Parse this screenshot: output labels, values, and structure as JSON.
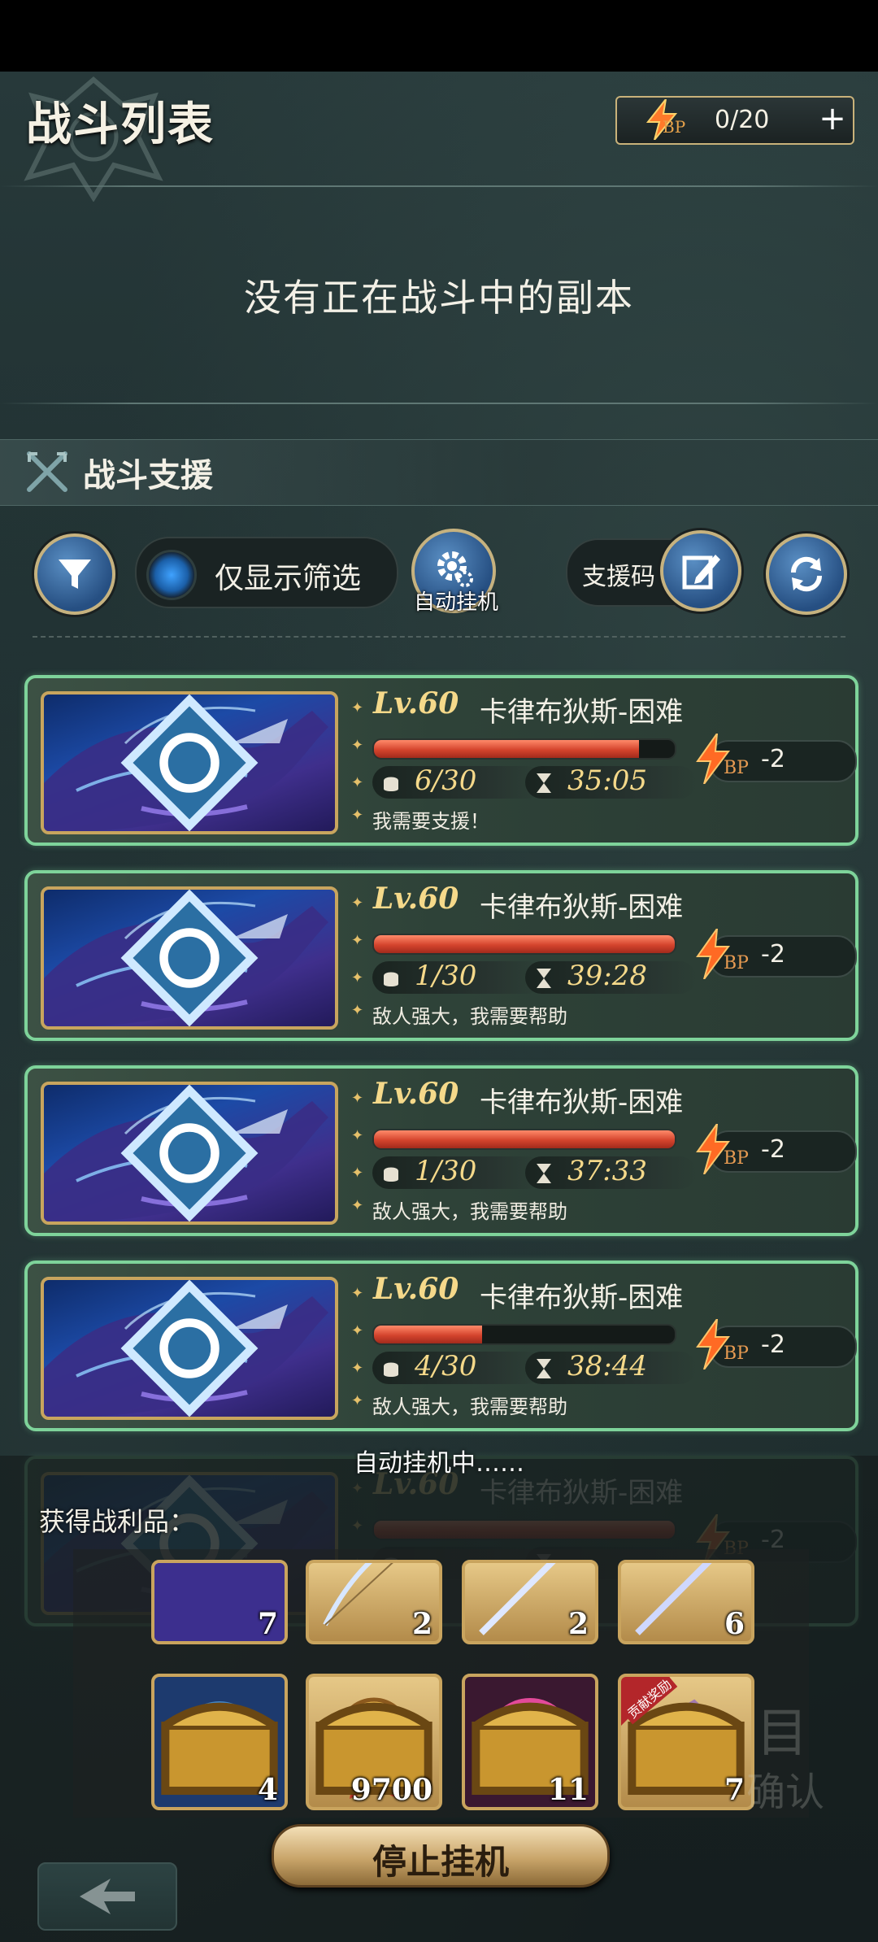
{
  "header": {
    "title": "战斗列表",
    "bp_icon_label": "BP",
    "bp_value": "0/20"
  },
  "empty_state": "没有正在战斗中的副本",
  "support_section": {
    "title": "战斗支援",
    "filter_toggle_label": "仅显示筛选",
    "auto_button_label": "自动挂机",
    "support_code_label": "支援码"
  },
  "battles": [
    {
      "level": "Lv.60",
      "name": "卡律布狄斯-困难",
      "hp_fraction": 0.88,
      "players": "6/30",
      "time": "35:05",
      "message": "我需要支援！",
      "cost_label": "BP",
      "cost": "-2"
    },
    {
      "level": "Lv.60",
      "name": "卡律布狄斯-困难",
      "hp_fraction": 1.0,
      "players": "1/30",
      "time": "39:28",
      "message": "敌人强大，我需要帮助",
      "cost_label": "BP",
      "cost": "-2"
    },
    {
      "level": "Lv.60",
      "name": "卡律布狄斯-困难",
      "hp_fraction": 1.0,
      "players": "1/30",
      "time": "37:33",
      "message": "敌人强大，我需要帮助",
      "cost_label": "BP",
      "cost": "-2"
    },
    {
      "level": "Lv.60",
      "name": "卡律布狄斯-困难",
      "hp_fraction": 0.36,
      "players": "4/30",
      "time": "38:44",
      "message": "敌人强大，我需要帮助",
      "cost_label": "BP",
      "cost": "-2"
    },
    {
      "level": "Lv.60",
      "name": "卡律布狄斯-困难",
      "hp_fraction": 1.0,
      "players": "",
      "time": "",
      "message": "",
      "cost_label": "BP",
      "cost": "-2"
    }
  ],
  "auto_farm": {
    "status": "自动挂机中……",
    "loot_label": "获得战利品：",
    "row1": [
      {
        "icon": "whale-thumbnail",
        "count": "7"
      },
      {
        "icon": "bow-icon",
        "count": "2"
      },
      {
        "icon": "staff-icon",
        "count": "2"
      },
      {
        "icon": "trident-icon",
        "count": "6"
      }
    ],
    "row2": [
      {
        "icon": "water-orb-icon",
        "count": "4"
      },
      {
        "icon": "medal-icon",
        "count": "9700"
      },
      {
        "icon": "pink-orb-icon",
        "count": "11"
      },
      {
        "icon": "dark-crystal-icon",
        "count": "7",
        "ribbon": "贡献奖励"
      }
    ],
    "stop_button": "停止挂机",
    "ghost_right": "确认"
  },
  "colors": {
    "card_border": "#7ed39a",
    "hp_fill": "#d4442d",
    "gold": "#c9a45e",
    "accent_blue": "#264f82"
  }
}
